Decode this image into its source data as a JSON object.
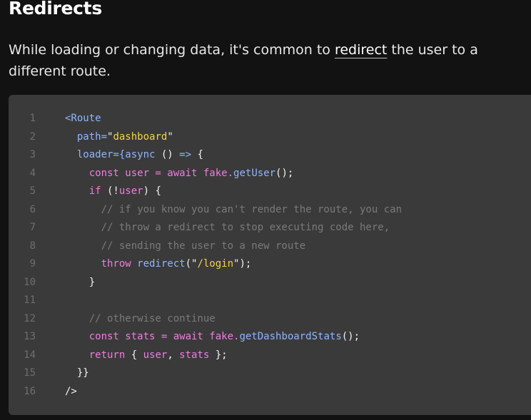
{
  "heading": "Redirects",
  "intro": {
    "before": "While loading or changing data, it's common to ",
    "link": "redirect",
    "after": " the user to a different route."
  },
  "code": {
    "lines": [
      {
        "n": "1",
        "tokens": [
          {
            "t": "<Route",
            "c": "tag"
          }
        ]
      },
      {
        "n": "2",
        "tokens": [
          {
            "t": "  path=",
            "c": "attr"
          },
          {
            "t": "\"",
            "c": "punc"
          },
          {
            "t": "dashboard",
            "c": "str"
          },
          {
            "t": "\"",
            "c": "punc"
          }
        ]
      },
      {
        "n": "3",
        "tokens": [
          {
            "t": "  loader={",
            "c": "attr"
          },
          {
            "t": "async",
            "c": "fn"
          },
          {
            "t": " () ",
            "c": "punc"
          },
          {
            "t": "=>",
            "c": "fn"
          },
          {
            "t": " {",
            "c": "punc"
          }
        ]
      },
      {
        "n": "4",
        "tokens": [
          {
            "t": "    const",
            "c": "kw"
          },
          {
            "t": " user = ",
            "c": "var"
          },
          {
            "t": "await",
            "c": "kw"
          },
          {
            "t": " fake.",
            "c": "var"
          },
          {
            "t": "getUser",
            "c": "fn"
          },
          {
            "t": "();",
            "c": "punc"
          }
        ]
      },
      {
        "n": "5",
        "tokens": [
          {
            "t": "    if",
            "c": "kw"
          },
          {
            "t": " (!",
            "c": "punc"
          },
          {
            "t": "user",
            "c": "var"
          },
          {
            "t": ") {",
            "c": "punc"
          }
        ]
      },
      {
        "n": "6",
        "tokens": [
          {
            "t": "      // if you know you can't render the route, you can",
            "c": "cm"
          }
        ]
      },
      {
        "n": "7",
        "tokens": [
          {
            "t": "      // throw a redirect to stop executing code here,",
            "c": "cm"
          }
        ]
      },
      {
        "n": "8",
        "tokens": [
          {
            "t": "      // sending the user to a new route",
            "c": "cm"
          }
        ]
      },
      {
        "n": "9",
        "tokens": [
          {
            "t": "      throw",
            "c": "kw"
          },
          {
            "t": " redirect",
            "c": "fn"
          },
          {
            "t": "(\"",
            "c": "punc"
          },
          {
            "t": "/login",
            "c": "str"
          },
          {
            "t": "\");",
            "c": "punc"
          }
        ]
      },
      {
        "n": "10",
        "tokens": [
          {
            "t": "    }",
            "c": "punc"
          }
        ]
      },
      {
        "n": "11",
        "tokens": []
      },
      {
        "n": "12",
        "tokens": [
          {
            "t": "    // otherwise continue",
            "c": "cm"
          }
        ]
      },
      {
        "n": "13",
        "tokens": [
          {
            "t": "    const",
            "c": "kw"
          },
          {
            "t": " stats = ",
            "c": "var"
          },
          {
            "t": "await",
            "c": "kw"
          },
          {
            "t": " fake.",
            "c": "var"
          },
          {
            "t": "getDashboardStats",
            "c": "fn"
          },
          {
            "t": "();",
            "c": "punc"
          }
        ]
      },
      {
        "n": "14",
        "tokens": [
          {
            "t": "    return",
            "c": "kw"
          },
          {
            "t": " { ",
            "c": "punc"
          },
          {
            "t": "user",
            "c": "var"
          },
          {
            "t": ", ",
            "c": "punc"
          },
          {
            "t": "stats",
            "c": "var"
          },
          {
            "t": " };",
            "c": "punc"
          }
        ]
      },
      {
        "n": "15",
        "tokens": [
          {
            "t": "  }}",
            "c": "punc"
          }
        ]
      },
      {
        "n": "16",
        "tokens": [
          {
            "t": "/>",
            "c": "punc"
          }
        ]
      }
    ]
  },
  "colors": {
    "background": "#121212",
    "code_background": "#3a3a3a",
    "keyword": "#f07ce0",
    "string": "#f3d24a",
    "function": "#8fb4ff",
    "comment": "#7a7a7a",
    "line_number": "#6e6e6e"
  }
}
